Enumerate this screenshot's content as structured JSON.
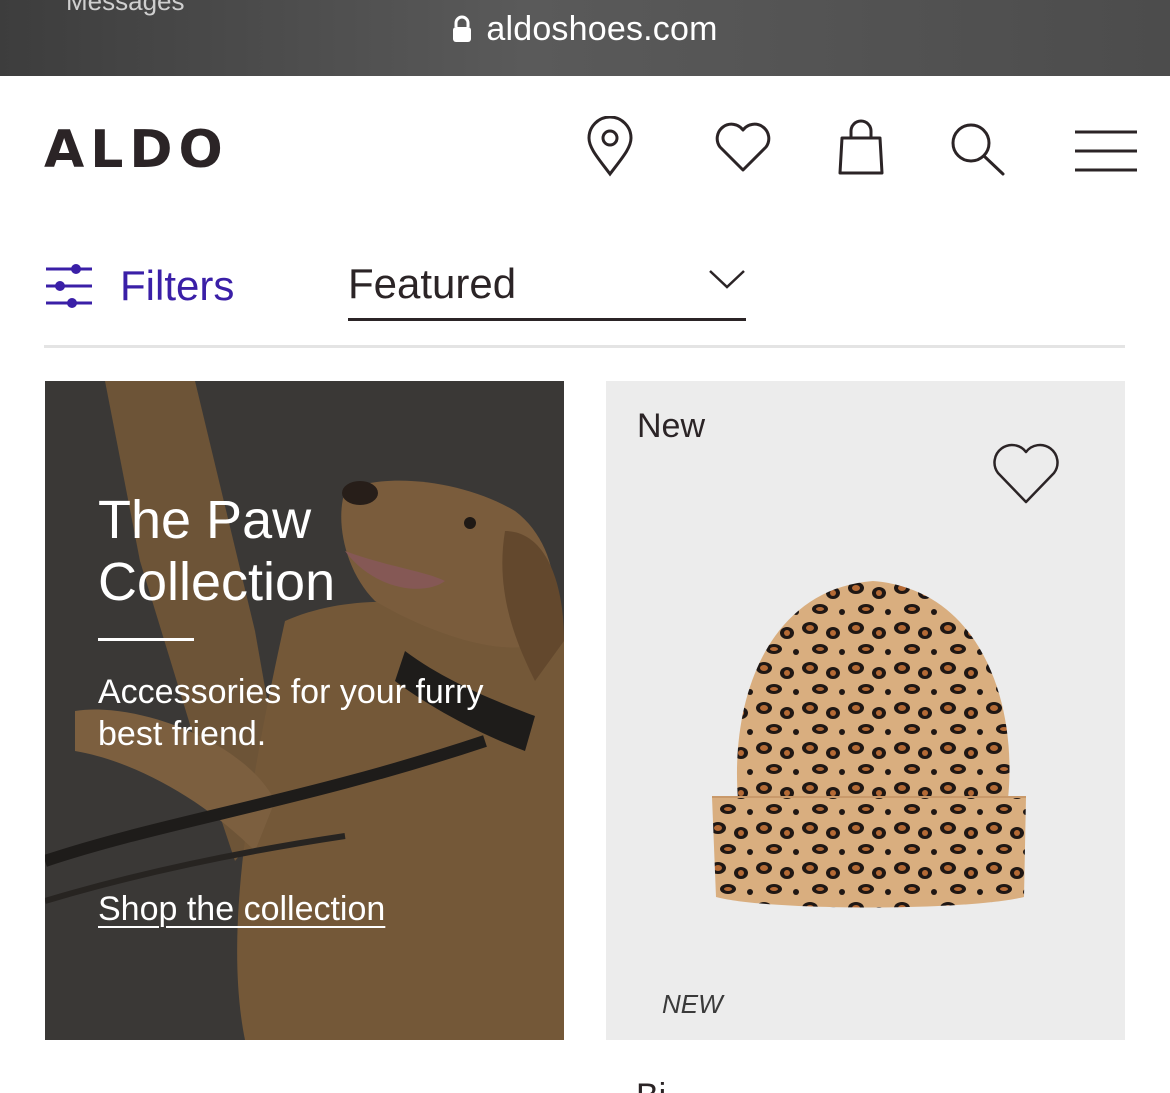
{
  "browser": {
    "prev_app": "Messages",
    "url": "aldoshoes.com"
  },
  "header": {
    "logo": "ALDO",
    "icons": [
      "location-icon",
      "heart-icon",
      "bag-icon",
      "search-icon",
      "menu-icon"
    ]
  },
  "toolbar": {
    "filters_label": "Filters",
    "sort_value": "Featured"
  },
  "promo": {
    "title": "The Paw Collection",
    "subtitle": "Accessories for your furry best friend.",
    "cta": "Shop the collection"
  },
  "product": {
    "badge": "New",
    "tag": "NEW",
    "name": "Bi"
  },
  "colors": {
    "brand_text": "#2b2426",
    "accent": "#3a1fa7",
    "tile_bg": "#ececec"
  }
}
